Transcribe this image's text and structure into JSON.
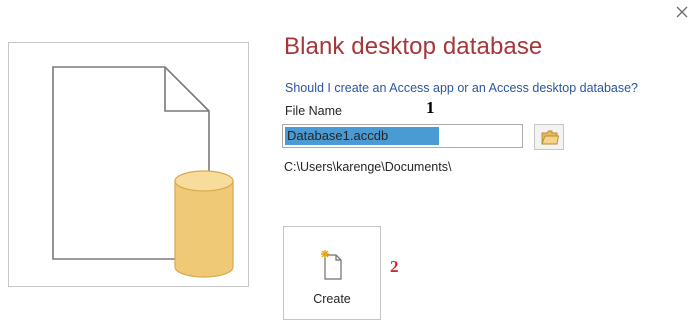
{
  "dialog": {
    "title": "Blank desktop database",
    "help_link": "Should I create an Access app or an Access desktop database?",
    "file_name_label": "File Name",
    "file_name_value": "Database1.accdb",
    "save_path": "C:\\Users\\karenge\\Documents\\",
    "create_label": "Create",
    "close_icon": "close-icon",
    "browse_icon": "folder-icon",
    "create_icon": "new-document-icon",
    "preview_icon": "blank-database-icon"
  },
  "annotations": {
    "marker_1": "1",
    "marker_2": "2"
  },
  "colors": {
    "title": "#a4373a",
    "link": "#2b579a",
    "selection": "#4a9ad4",
    "database_cylinder": "#f0c977",
    "marker_2": "#d42a2a"
  }
}
